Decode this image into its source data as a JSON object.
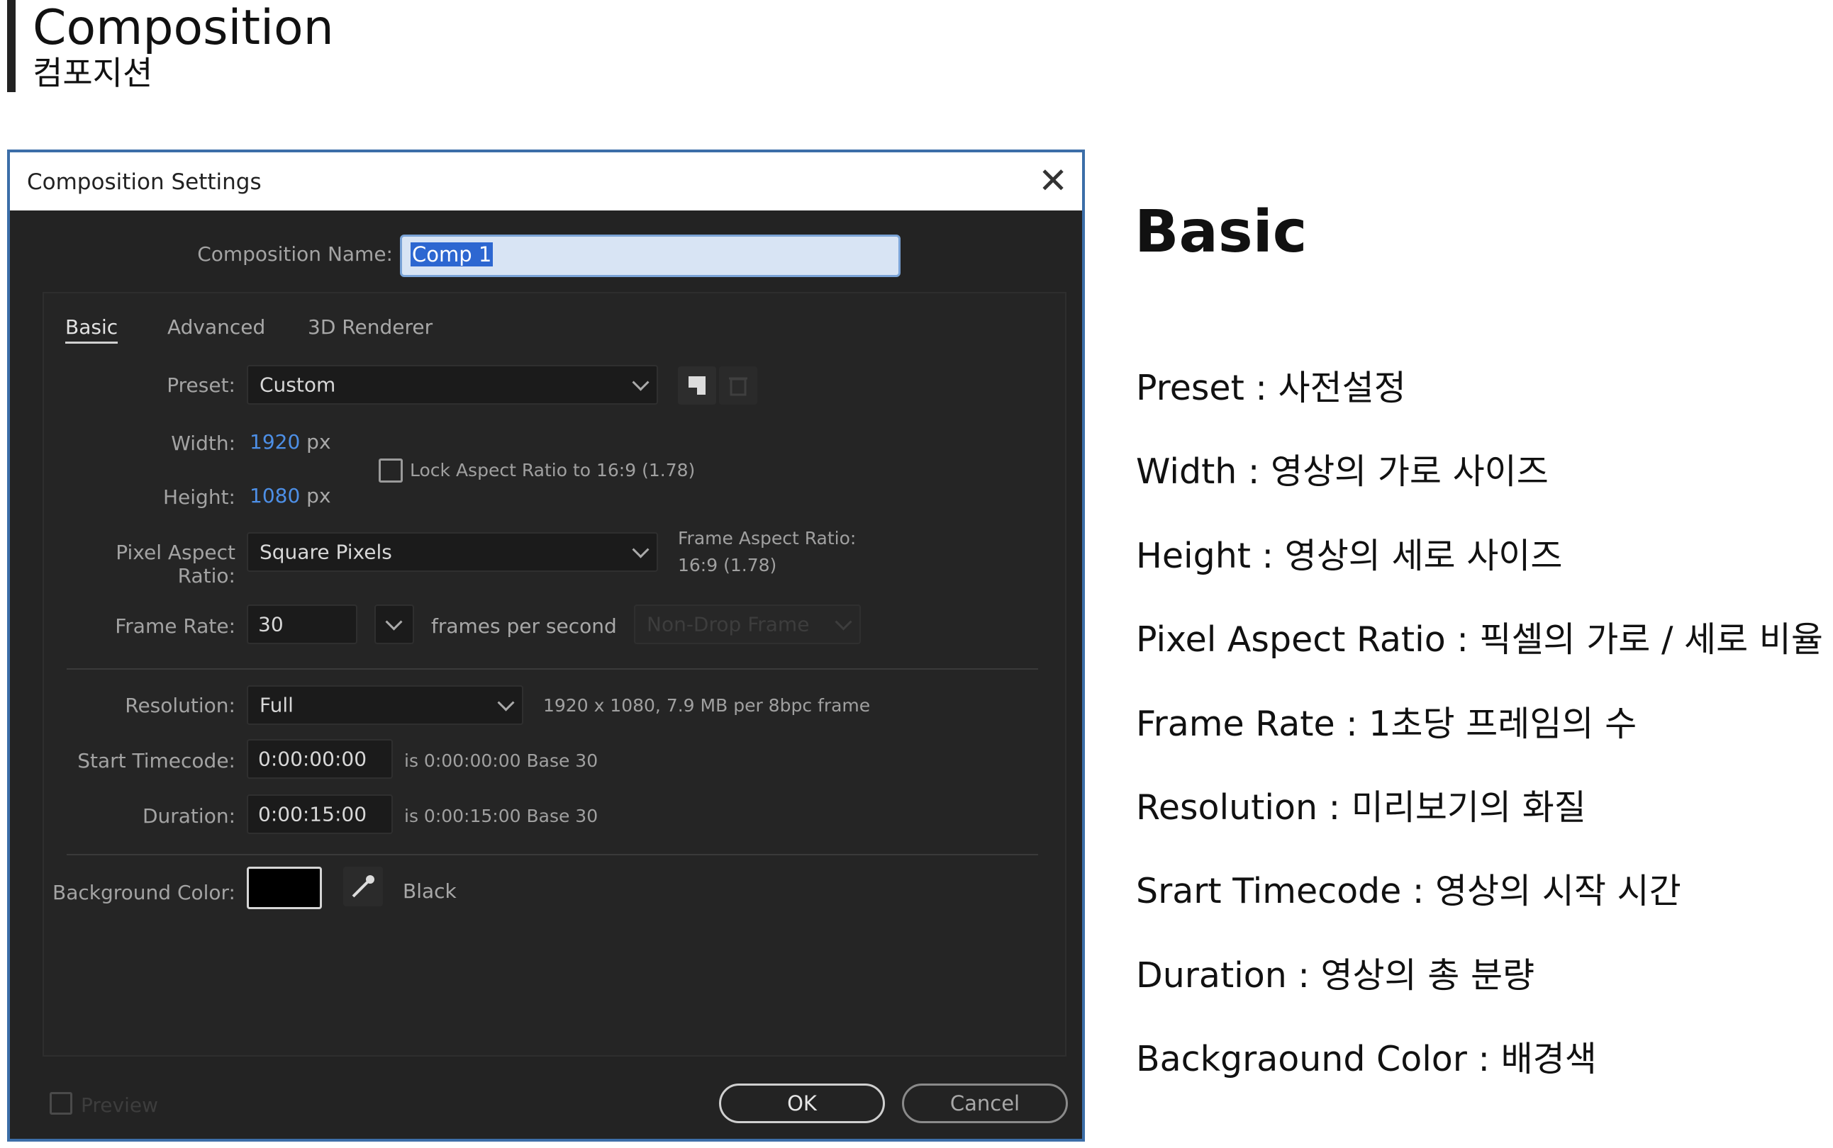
{
  "header": {
    "title": "Composition",
    "subtitle": "컴포지션"
  },
  "dialog": {
    "title": "Composition Settings",
    "close_label": "✕",
    "name_label": "Composition Name:",
    "name_value": "Comp 1",
    "tabs": [
      {
        "label": "Basic",
        "active": true
      },
      {
        "label": "Advanced",
        "active": false
      },
      {
        "label": "3D Renderer",
        "active": false
      }
    ],
    "preset_label": "Preset:",
    "preset_value": "Custom",
    "width_label": "Width:",
    "width_value": "1920",
    "height_label": "Height:",
    "height_value": "1080",
    "unit_px": "px",
    "lock_label": "Lock Aspect Ratio to 16:9 (1.78)",
    "par_label": "Pixel Aspect Ratio:",
    "par_value": "Square Pixels",
    "far_label": "Frame Aspect Ratio:",
    "far_value": "16:9 (1.78)",
    "frame_rate_label": "Frame Rate:",
    "frame_rate_value": "30",
    "fps_label": "frames per second",
    "drop_frame_value": "Non-Drop Frame",
    "resolution_label": "Resolution:",
    "resolution_value": "Full",
    "resolution_info": "1920 x 1080, 7.9 MB per 8bpc frame",
    "start_tc_label": "Start Timecode:",
    "start_tc_value": "0:00:00:00",
    "start_tc_info": "is 0:00:00:00  Base 30",
    "duration_label": "Duration:",
    "duration_value": "0:00:15:00",
    "duration_info": "is 0:00:15:00  Base 30",
    "bg_label": "Background Color:",
    "bg_color_name": "Black",
    "bg_color": "#000000",
    "preview_label": "Preview",
    "ok_label": "OK",
    "cancel_label": "Cancel"
  },
  "notes": {
    "heading": "Basic",
    "items": [
      "Preset : 사전설정",
      "Width : 영상의 가로 사이즈",
      "Height : 영상의 세로 사이즈",
      "Pixel Aspect Ratio : 픽셀의 가로 / 세로 비율",
      "Frame Rate : 1초당 프레임의 수",
      "Resolution : 미리보기의 화질",
      "Srart Timecode : 영상의 시작 시간",
      "Duration : 영상의 총 분량",
      "Backgraound Color : 배경색"
    ]
  }
}
